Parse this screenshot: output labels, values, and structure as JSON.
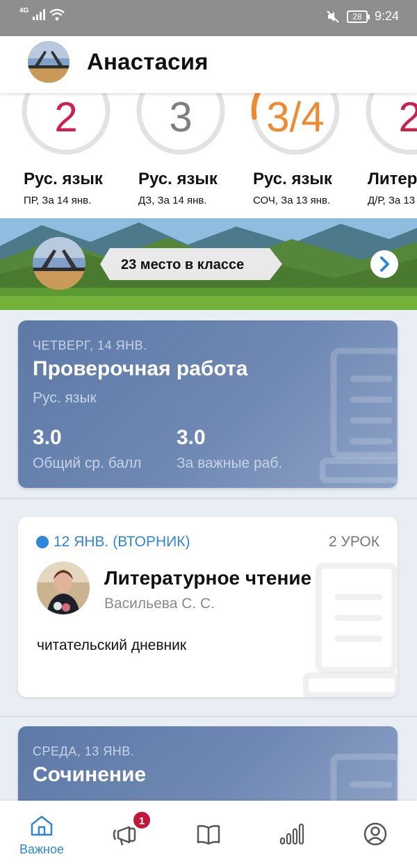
{
  "status_bar": {
    "network": "4G",
    "time": "9:24",
    "battery": "28"
  },
  "header": {
    "name": "Анастасия"
  },
  "grades": [
    {
      "value": "2",
      "subject": "Рус. язык",
      "meta": "ПР, За 14 янв.",
      "color": "#cc1f4e"
    },
    {
      "value": "3",
      "subject": "Рус. язык",
      "meta": "ДЗ, За 14 янв.",
      "color": "#7f7f7f"
    },
    {
      "value": "3/4",
      "subject": "Рус. язык",
      "meta": "СОЧ, За 13 янв.",
      "color": "#ef8a2e"
    },
    {
      "value": "2",
      "subject": "Литер",
      "meta": "Д/Р, За 13",
      "color": "#cc1f4e"
    }
  ],
  "rank": {
    "text": "23 место в классе"
  },
  "cards": {
    "work": {
      "date": "ЧЕТВЕРГ, 14 ЯНВ.",
      "title": "Проверочная работа",
      "subject": "Рус. язык",
      "avg_value": "3.0",
      "avg_label": "Общий ср. балл",
      "important_value": "3.0",
      "important_label": "За важные раб."
    },
    "homework": {
      "date": "12 ЯНВ. (ВТОРНИК)",
      "lesson": "2 УРОК",
      "course": "Литературное чтение",
      "teacher": "Васильева С. С.",
      "task": "читательский дневник"
    },
    "essay": {
      "date": "СРЕДА, 13 ЯНВ.",
      "title": "Сочинение"
    }
  },
  "nav": {
    "items": [
      {
        "label": "Важное",
        "icon": "home-icon"
      },
      {
        "label": "",
        "icon": "megaphone-icon",
        "badge": "1"
      },
      {
        "label": "",
        "icon": "book-icon"
      },
      {
        "label": "",
        "icon": "stats-icon"
      },
      {
        "label": "",
        "icon": "profile-icon"
      }
    ]
  },
  "colors": {
    "accent": "#2f86d9",
    "alert": "#c3173a",
    "card_blue": "#6f88b3"
  }
}
